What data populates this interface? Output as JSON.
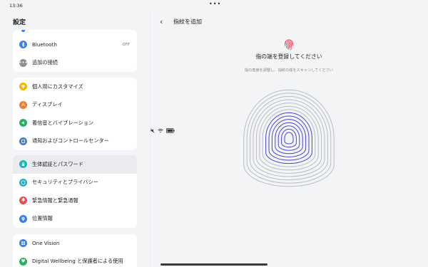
{
  "status": {
    "time": "13:36",
    "center": "•••"
  },
  "sidebar": {
    "title": "設定",
    "groups": [
      {
        "items": [
          {
            "label": "Bluetooth",
            "value": "OFF",
            "color": "#3b82f6",
            "icon": "bluetooth-icon"
          },
          {
            "label": "追加の接続",
            "color": "#8e8e93",
            "icon": "more-dots-icon"
          }
        ]
      },
      {
        "items": [
          {
            "label": "個人用にカスタマイズ",
            "color": "#f5b400",
            "icon": "personalize-icon"
          },
          {
            "label": "ディスプレイ",
            "color": "#f07c2b",
            "icon": "display-icon"
          },
          {
            "label": "着信音とバイブレーション",
            "color": "#22b35e",
            "icon": "sound-icon"
          },
          {
            "label": "通知およびコントロールセンター",
            "color": "#3b7cf0",
            "icon": "notification-icon"
          }
        ]
      },
      {
        "items": [
          {
            "label": "生体認証とパスワード",
            "color": "#16b8b0",
            "icon": "lock-icon",
            "selected": true
          },
          {
            "label": "セキュリティとプライバシー",
            "color": "#19b0c8",
            "icon": "shield-icon"
          },
          {
            "label": "緊急情報と緊急通報",
            "color": "#ee4b4b",
            "icon": "emergency-icon"
          },
          {
            "label": "位置情報",
            "color": "#3b7cf0",
            "icon": "location-icon"
          }
        ]
      },
      {
        "items": [
          {
            "label": "One Vision",
            "color": "#3b7cf0",
            "icon": "one-vision-icon"
          },
          {
            "label": "Digital Wellbeing と保護者による使用",
            "color": "#22b35e",
            "icon": "wellbeing-icon"
          }
        ]
      }
    ]
  },
  "page": {
    "back_glyph": "‹",
    "title": "指紋を追加",
    "heading": "指の端を登録してください",
    "subtext": "指の角度を調整し、指紋の端をスキャンしてください",
    "accent": "#e8475f",
    "ring_color": "#4b43d6"
  }
}
